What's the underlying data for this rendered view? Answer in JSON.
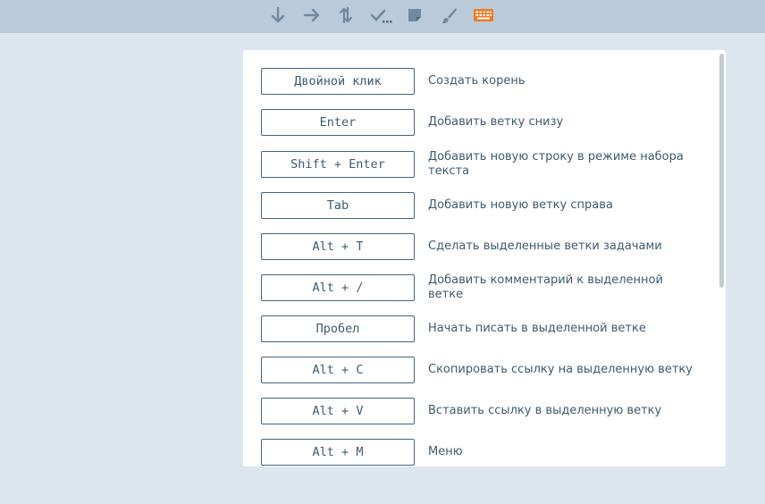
{
  "toolbar": {
    "tools": [
      {
        "icon": "arrow-down-icon"
      },
      {
        "icon": "arrow-right-icon"
      },
      {
        "icon": "swap-vertical-icon"
      },
      {
        "icon": "check-more-icon"
      },
      {
        "icon": "sticky-note-icon"
      },
      {
        "icon": "brush-icon"
      },
      {
        "icon": "keyboard-icon",
        "active": true
      }
    ],
    "icon_color": "#6f8aa0",
    "active_color": "#f07a1f"
  },
  "shortcuts": {
    "items": [
      {
        "key": "Двойной клик",
        "action": "Создать корень"
      },
      {
        "key": "Enter",
        "action": "Добавить ветку снизу"
      },
      {
        "key": "Shift + Enter",
        "action": "Добавить новую строку в режиме набора текста"
      },
      {
        "key": "Tab",
        "action": "Добавить новую ветку справа"
      },
      {
        "key": "Alt + T",
        "action": "Сделать выделенные ветки задачами"
      },
      {
        "key": "Alt + /",
        "action": "Добавить комментарий к выделенной ветке"
      },
      {
        "key": "Пробел",
        "action": "Начать писать в выделенной ветке"
      },
      {
        "key": "Alt + C",
        "action": "Скопировать ссылку на выделенную ветку"
      },
      {
        "key": "Alt + V",
        "action": "Вставить ссылку в выделенную ветку"
      },
      {
        "key": "Alt + M",
        "action": "Меню"
      }
    ]
  }
}
